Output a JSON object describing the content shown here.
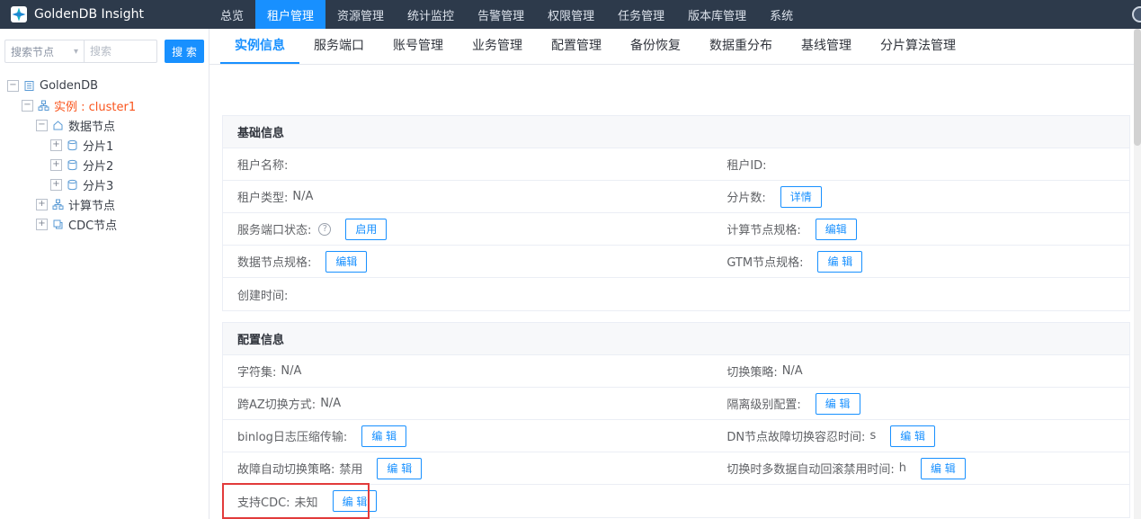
{
  "colors": {
    "accent": "#1890ff",
    "topbar_bg": "#2d3a4b",
    "instance_text": "#fa541c",
    "highlight_box": "#e23b3b"
  },
  "icons": {
    "search_caret": "▾",
    "help": "?",
    "toggle_expanded": "−",
    "toggle_collapsed": "+"
  },
  "topbar": {
    "brand": "GoldenDB Insight",
    "nav": [
      {
        "label": "总览"
      },
      {
        "label": "租户管理"
      },
      {
        "label": "资源管理"
      },
      {
        "label": "统计监控"
      },
      {
        "label": "告警管理"
      },
      {
        "label": "权限管理"
      },
      {
        "label": "任务管理"
      },
      {
        "label": "版本库管理"
      },
      {
        "label": "系统"
      }
    ]
  },
  "sidebar": {
    "search_type": "搜索节点",
    "search_placeholder": "搜索",
    "search_button": "搜 索",
    "tree": {
      "root": "GoldenDB",
      "instance": "实例 : cluster1",
      "data_node": "数据节点",
      "shard1": "分片1",
      "shard2": "分片2",
      "shard3": "分片3",
      "compute_node": "计算节点",
      "cdc_node": "CDC节点"
    }
  },
  "tabs": [
    "实例信息",
    "服务端口",
    "账号管理",
    "业务管理",
    "配置管理",
    "备份恢复",
    "数据重分布",
    "基线管理",
    "分片算法管理"
  ],
  "basic": {
    "title": "基础信息",
    "tenant_name": "租户名称:",
    "tenant_id": "租户ID:",
    "tenant_type_label": "租户类型:",
    "tenant_type_value": "N/A",
    "shard_count_label": "分片数:",
    "shard_count_btn": "详情",
    "service_port_label": "服务端口状态:",
    "service_port_btn": "启用",
    "compute_spec_label": "计算节点规格:",
    "compute_spec_btn": "编辑",
    "data_spec_label": "数据节点规格:",
    "data_spec_btn": "编辑",
    "gtm_spec_label": "GTM节点规格:",
    "gtm_spec_btn": "编 辑",
    "create_time": "创建时间:"
  },
  "config": {
    "title": "配置信息",
    "charset_label": "字符集:",
    "charset_value": "N/A",
    "switch_policy_label": "切换策略:",
    "switch_policy_value": "N/A",
    "az_switch_label": "跨AZ切换方式:",
    "az_switch_value": "N/A",
    "isolation_label": "隔离级别配置:",
    "isolation_btn": "编 辑",
    "binlog_label": "binlog日志压缩传输:",
    "binlog_btn": "编 辑",
    "dn_tolerate_label": "DN节点故障切换容忍时间:",
    "dn_tolerate_value": "s",
    "dn_tolerate_btn": "编 辑",
    "auto_switch_label": "故障自动切换策略:",
    "auto_switch_value": "禁用",
    "auto_switch_btn": "编 辑",
    "rollback_label": "切换时多数据自动回滚禁用时间:",
    "rollback_value": "h",
    "rollback_btn": "编 辑",
    "cdc_label": "支持CDC:",
    "cdc_value": "未知",
    "cdc_btn": "编 辑"
  }
}
